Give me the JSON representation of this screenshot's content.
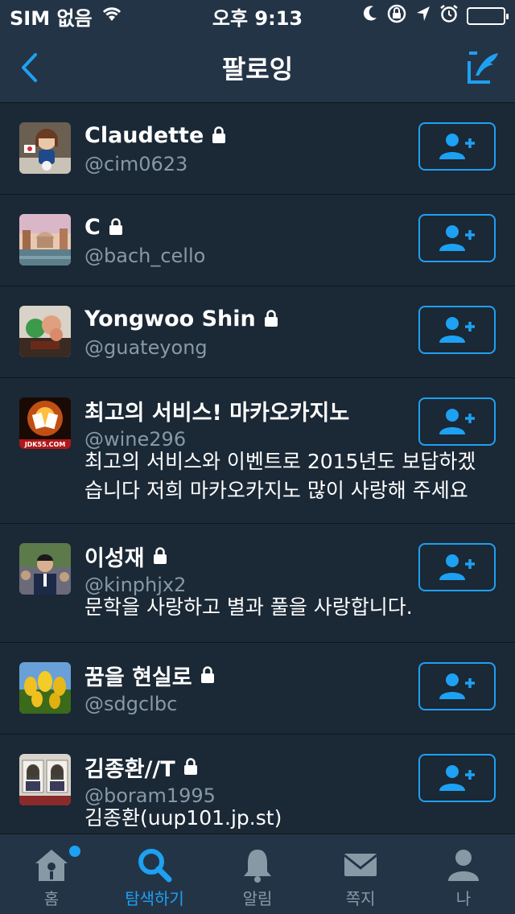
{
  "status_bar": {
    "carrier": "SIM 없음",
    "time": "오후 9:13"
  },
  "nav": {
    "title": "팔로잉",
    "back_icon": "chevron-left-icon",
    "compose_icon": "compose-icon"
  },
  "users": [
    {
      "name": "Claudette",
      "handle": "@cim0623",
      "locked": true,
      "bio": ""
    },
    {
      "name": "C",
      "handle": "@bach_cello",
      "locked": true,
      "bio": ""
    },
    {
      "name": "Yongwoo Shin",
      "handle": "@guateyong",
      "locked": true,
      "bio": ""
    },
    {
      "name": "최고의 서비스! 마카오카지노",
      "handle": "@wine296",
      "locked": false,
      "bio": "최고의 서비스와 이벤트로 2015년도 보답하겠습니다 저희 마카오카지노 많이 사랑해 주세요",
      "bio_line1": "최고의 서비스와 이벤트로 2015년도 보답하겠",
      "bio_line2": "습니다 저희 마카오카지노 많이 사랑해 주세요"
    },
    {
      "name": "이성재",
      "handle": "@kinphjx2",
      "locked": true,
      "bio": "문학을 사랑하고 별과 풀을 사랑합니다."
    },
    {
      "name": "꿈을 현실로",
      "handle": "@sdgclbc",
      "locked": true,
      "bio": ""
    },
    {
      "name": "김종환//T",
      "handle": "@boram1995",
      "locked": true,
      "bio": "김종환(uup101.jp.st)"
    }
  ],
  "tabs": [
    {
      "label": "홈",
      "icon": "home-icon",
      "active": false,
      "badge": true
    },
    {
      "label": "탐색하기",
      "icon": "search-icon",
      "active": true,
      "badge": false
    },
    {
      "label": "알림",
      "icon": "bell-icon",
      "active": false,
      "badge": false
    },
    {
      "label": "쪽지",
      "icon": "envelope-icon",
      "active": false,
      "badge": false
    },
    {
      "label": "나",
      "icon": "person-icon",
      "active": false,
      "badge": false
    }
  ],
  "colors": {
    "accent": "#1da1f2",
    "background": "#1b2836",
    "bar": "#243447",
    "secondary_text": "#8899a6"
  }
}
